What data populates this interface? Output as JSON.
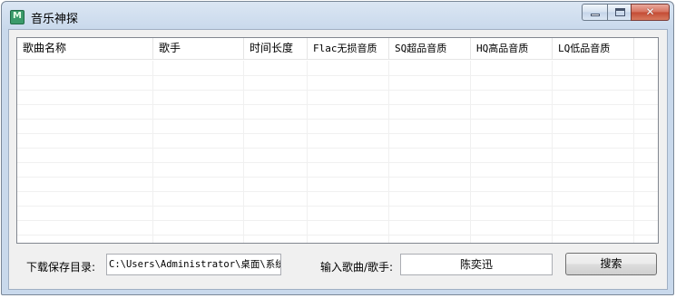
{
  "window": {
    "title": "音乐神探",
    "close_glyph": "✕"
  },
  "table": {
    "columns": [
      "歌曲名称",
      "歌手",
      "时间长度",
      "Flac无损音质",
      "SQ超品音质",
      "HQ高品音质",
      "LQ低品音质"
    ],
    "rows": []
  },
  "footer": {
    "path_label": "下载保存目录:",
    "path_value": "C:\\Users\\Administrator\\桌面\\系统",
    "search_label": "输入歌曲/歌手:",
    "search_value": "陈奕迅",
    "search_button": "搜索"
  },
  "colors": {
    "titlebar": "#c9d9ec",
    "client": "#f0f0f0",
    "close_button": "#c34a33"
  }
}
